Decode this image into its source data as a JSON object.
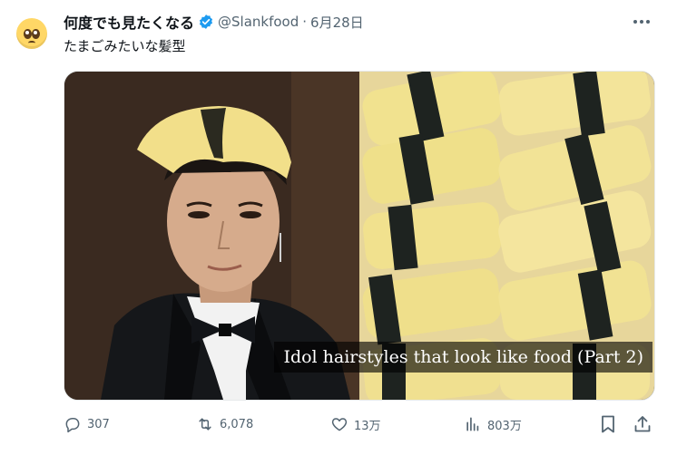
{
  "tweet": {
    "avatar_icon": "pleading-face-emoji",
    "display_name": "何度でも見たくなる",
    "handle": "@Slankfood",
    "separator": "·",
    "date": "6月28日",
    "text": "たまごみたいな髪型",
    "media_caption": "Idol hairstyles that look like food (Part 2)"
  },
  "actions": {
    "reply_count": "307",
    "retweet_count": "6,078",
    "like_count": "13万",
    "view_count": "803万"
  },
  "colors": {
    "verified": "#1d9bf0",
    "secondary_text": "#536471",
    "primary_text": "#0f1419",
    "egg": "#f2df8a",
    "nori": "#1e2320"
  }
}
